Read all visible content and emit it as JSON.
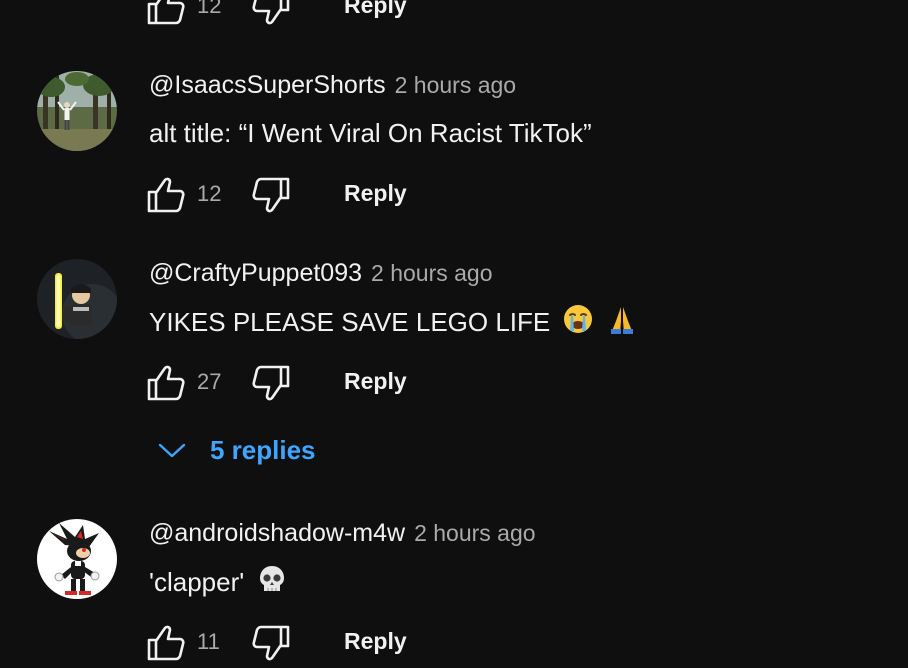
{
  "comments": [
    {
      "author": "",
      "time": "",
      "text": "",
      "likes": "12",
      "reply_label": "Reply"
    },
    {
      "author": "@IsaacsSuperShorts",
      "time": "2 hours ago",
      "text": "alt title: “I Went Viral On Racist TikTok”",
      "likes": "12",
      "reply_label": "Reply"
    },
    {
      "author": "@CraftyPuppet093",
      "time": "2 hours ago",
      "text": "YIKES PLEASE SAVE LEGO LIFE",
      "emojis": [
        "crying-face",
        "folded-hands"
      ],
      "likes": "27",
      "reply_label": "Reply",
      "replies_label": "5 replies"
    },
    {
      "author": "@androidshadow-m4w",
      "time": "2 hours ago",
      "text": "'clapper'",
      "emojis": [
        "skull"
      ],
      "likes": "11",
      "reply_label": "Reply"
    }
  ],
  "colors": {
    "background": "#0f0f0f",
    "primary_text": "#f1f1f1",
    "secondary_text": "#aaaaaa",
    "link_blue": "#3ea6ff"
  }
}
